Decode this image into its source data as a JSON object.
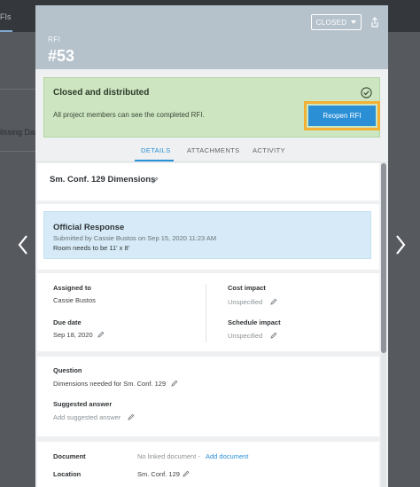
{
  "background": {
    "tab_fragment": "FIs",
    "row_fragment": "lissing Dam"
  },
  "header": {
    "label": "RFI",
    "number": "#53",
    "status": "CLOSED"
  },
  "banner": {
    "title": "Closed and distributed",
    "description": "All project members can see the completed RFI.",
    "button": "Reopen RFI"
  },
  "tabs": [
    {
      "label": "DETAILS"
    },
    {
      "label": "ATTACHMENTS"
    },
    {
      "label": "ACTIVITY"
    }
  ],
  "subject": "Sm. Conf. 129 Dimensions",
  "official_response": {
    "title": "Official Response",
    "meta": "Submitted by Cassie Bustos on Sep 15, 2020 11:23 AM",
    "body": "Room needs to be 11' x 8'"
  },
  "fields": {
    "assigned_to_label": "Assigned to",
    "assigned_to_value": "Cassie Bustos",
    "due_date_label": "Due date",
    "due_date_value": "Sep 18, 2020",
    "cost_impact_label": "Cost impact",
    "cost_impact_value": "Unspecified",
    "schedule_impact_label": "Schedule impact",
    "schedule_impact_value": "Unspecified"
  },
  "question": {
    "label": "Question",
    "value": "Dimensions needed for Sm. Conf. 129",
    "suggested_label": "Suggested answer",
    "suggested_placeholder": "Add suggested answer"
  },
  "references": {
    "document_label": "Document",
    "document_value": "No linked document -",
    "document_link": "Add document",
    "location_label": "Location",
    "location_value": "Sm. Conf. 129"
  },
  "colors": {
    "accent": "#2b8fd6",
    "banner": "#cde6c1",
    "highlight": "#f2b134",
    "header": "#b5c1cb"
  }
}
